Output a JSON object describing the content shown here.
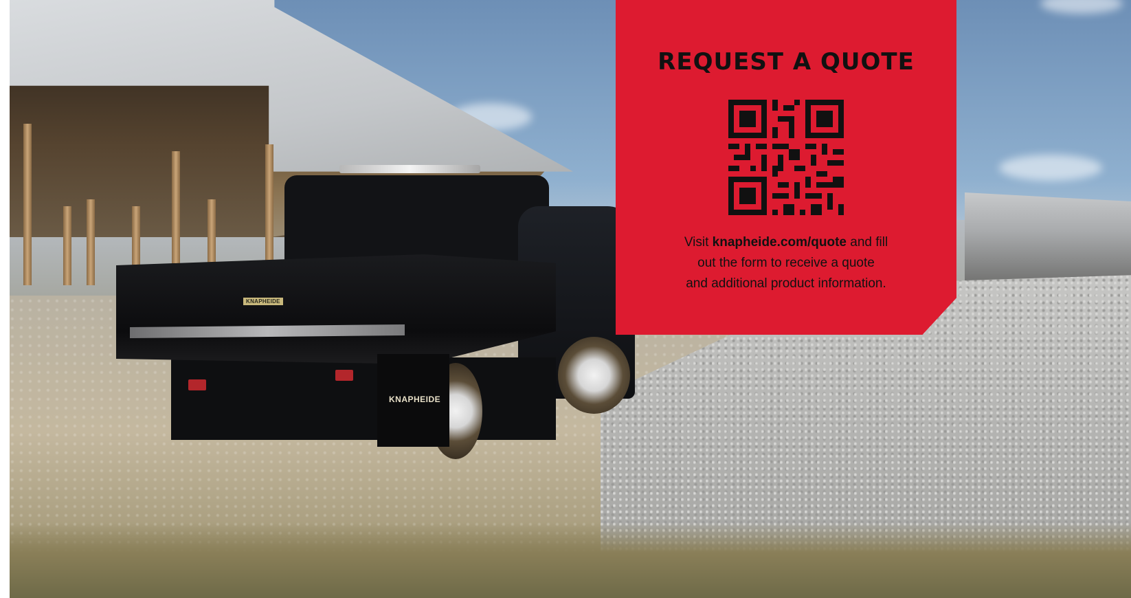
{
  "quote_panel": {
    "title": "REQUEST A QUOTE",
    "line1_prefix": "Visit ",
    "url": "knapheide.com/quote",
    "line1_suffix": " and fill",
    "line2": "out the form to receive a quote",
    "line3": "and additional product information.",
    "panel_color": "#dd1b30"
  },
  "truck": {
    "body_badge": "KNAPHEIDE",
    "mudflap_brand": "KNAPHEIDE"
  },
  "icons": {
    "qr": "qr-code-icon"
  }
}
